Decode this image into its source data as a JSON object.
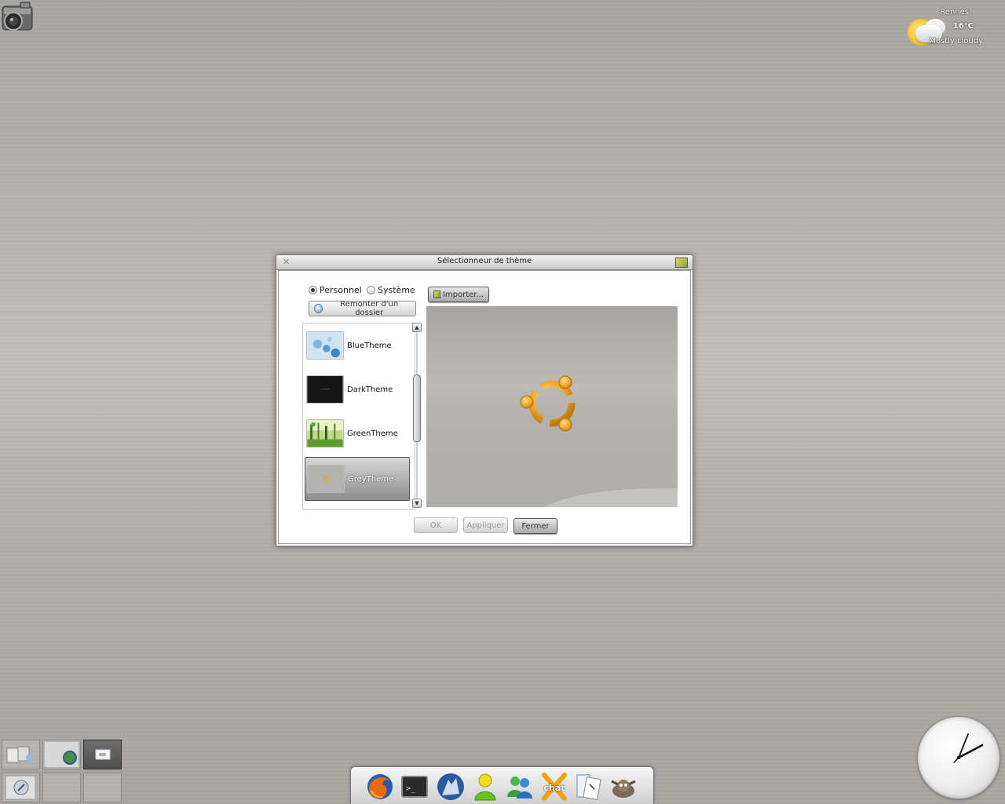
{
  "weather": {
    "city": "Rennes",
    "temperature": "16°C",
    "condition": "Mostly cloudy"
  },
  "dialog": {
    "title": "Sélectionneur de thème",
    "close_glyph": "✕",
    "source_options": [
      {
        "label": "Personnel",
        "selected": true
      },
      {
        "label": "Système",
        "selected": false
      }
    ],
    "parent_folder_label": "Remonter d'un dossier",
    "import_label": "Importer...",
    "themes": [
      {
        "name": "BlueTheme",
        "selected": false
      },
      {
        "name": "DarkTheme",
        "selected": false
      },
      {
        "name": "GreenTheme",
        "selected": false
      },
      {
        "name": "GreyTheme",
        "selected": true
      }
    ],
    "buttons": {
      "ok": "OK",
      "apply": "Appliquer",
      "close": "Fermer"
    }
  },
  "dock": {
    "icons": [
      "firefox-icon",
      "terminal-icon",
      "wolf-icon",
      "buddy-icon",
      "messenger-icon",
      "xchat-icon",
      "text-editor-icon",
      "gimp-icon"
    ],
    "xchat_text": "chat"
  },
  "pager": {
    "desktops": 6,
    "active": 3
  },
  "colors": {
    "accent": "#f0a020",
    "selected_item": "#8c8c8c"
  }
}
